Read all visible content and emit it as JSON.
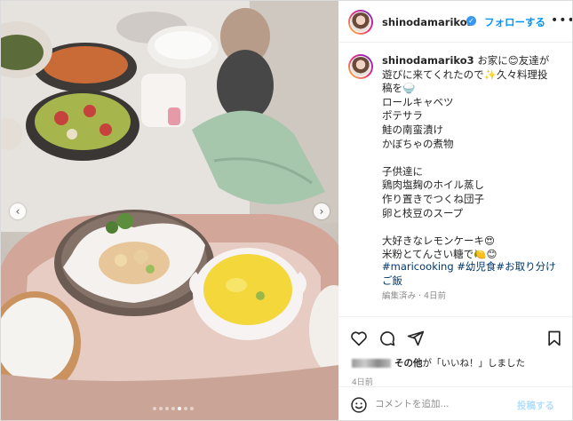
{
  "post": {
    "username": "shinodamariko3",
    "follow_label": "フォローする",
    "more_label": "•••"
  },
  "caption": {
    "username": "shinodamariko3",
    "lines": [
      "お家に😊友達が",
      "遊びに来てくれたので✨久々料理投",
      "稿を🍚",
      "ロールキャベツ",
      "ポテサラ",
      "鮭の南蛮漬け",
      "かぼちゃの煮物",
      "",
      "子供達に",
      "鶏肉塩麹のホイル蒸し",
      "作り置きでつくね団子",
      "卵と枝豆のスープ",
      "",
      "大好きなレモンケーキ😍",
      "米粉とてんさい糖で🍋😊"
    ],
    "hashtags": "#maricooking #幼児食#お取り分けご飯",
    "meta": "編集済み · 4日前"
  },
  "likes": {
    "text_suffix": "その他",
    "text_tail": "が「いいね！」しました"
  },
  "timestamp": "4日前",
  "comment": {
    "placeholder": "コメントを追加...",
    "post_label": "投稿する"
  },
  "carousel": {
    "prev": "‹",
    "next": "›",
    "dot_count": 7,
    "active_dot": 4
  },
  "colors": {
    "link_blue": "#0095f6",
    "hashtag": "#00376b",
    "muted": "#8e8e8e"
  }
}
